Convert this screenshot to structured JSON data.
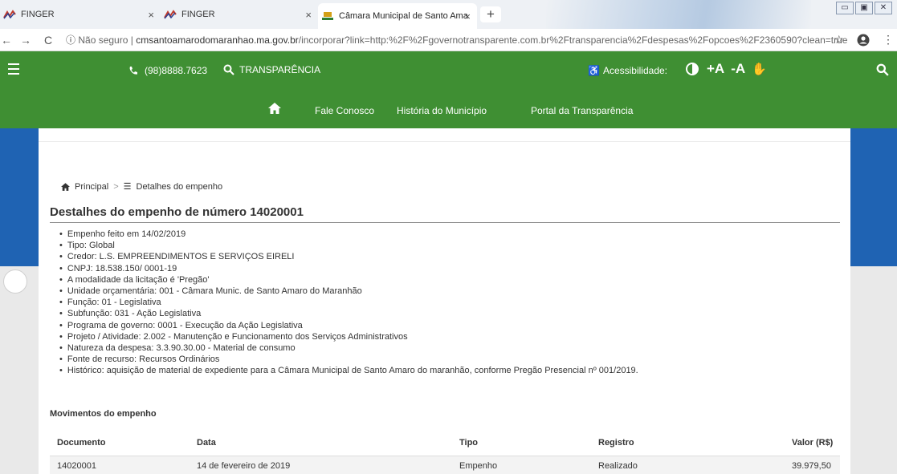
{
  "browser": {
    "tabs": [
      {
        "title": "FINGER",
        "close": "×"
      },
      {
        "title": "FINGER",
        "close": "×"
      },
      {
        "title": "Câmara Municipal de Santo Ama",
        "close": "×"
      }
    ],
    "new_tab": "+",
    "address": {
      "security": "Não seguro",
      "domain": "cmsantoamarodomaranhao.ma.gov.br",
      "path": "/incorporar?link=http:%2F%2Fgovernotransparente.com.br%2Ftransparencia%2Fdespesas%2Fopcoes%2F2360590?clean=true"
    }
  },
  "header": {
    "phone": "(98)8888.7623",
    "transparency": "TRANSPARÊNCIA",
    "accessibility_label": "Acessibilidade:",
    "font_increase": "+A",
    "font_decrease": "-A"
  },
  "nav": {
    "items": [
      "Fale Conosco",
      "História do Município",
      "Portal da Transparência"
    ]
  },
  "breadcrumb": {
    "home": "Principal",
    "separator": ">",
    "current": "Detalhes do empenho"
  },
  "page": {
    "title": "Destalhes do empenho de número 14020001",
    "details": [
      "Empenho feito em 14/02/2019",
      "Tipo: Global",
      "Credor: L.S. EMPREENDIMENTOS E SERVIÇOS EIRELI",
      "CNPJ: 18.538.150/ 0001-19",
      "A modalidade da licitação é 'Pregão'",
      "Unidade orçamentária: 001 - Câmara Munic. de Santo Amaro do Maranhão",
      "Função: 01 - Legislativa",
      "Subfunção: 031 - Ação Legislativa",
      "Programa de governo: 0001 - Execução da Ação Legislativa",
      "Projeto / Atividade: 2.002 - Manutenção e Funcionamento dos Serviços Administrativos",
      "Natureza da despesa: 3.3.90.30.00 - Material de consumo",
      "Fonte de recurso: Recursos Ordinários",
      "Histórico: aquisição de material de expediente para a Câmara Municipal de Santo Amaro do maranhão, conforme Pregão Presencial nº 001/2019."
    ],
    "movements_title": "Movimentos do empenho",
    "table": {
      "headers": [
        "Documento",
        "Data",
        "Tipo",
        "Registro",
        "Valor (R$)"
      ],
      "rows": [
        [
          "14020001",
          "14 de fevereiro de 2019",
          "Empenho",
          "Realizado",
          "39.979,50"
        ]
      ]
    }
  },
  "colors": {
    "header_green": "#3f8f33",
    "side_blue": "#1f63b3"
  }
}
